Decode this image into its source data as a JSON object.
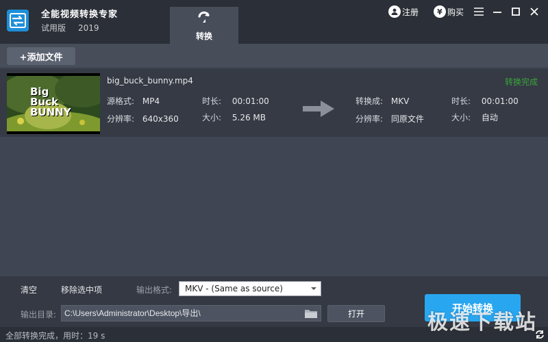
{
  "app": {
    "name": "全能视频转换专家",
    "edition": "试用版",
    "year": "2019"
  },
  "tabs": [
    {
      "label": "转换",
      "icon": "convert-arrow-icon",
      "active": true
    }
  ],
  "top_actions": {
    "register_label": "注册",
    "buy_label": "购买"
  },
  "toolbar": {
    "add_file_label": "+添加文件"
  },
  "files": [
    {
      "name": "big_buck_bunny.mp4",
      "thumbnail_title": "Big Buck BUNNY",
      "source": {
        "format_key": "源格式:",
        "format": "MP4",
        "resolution_key": "分辨率:",
        "resolution": "640x360",
        "duration_key": "时长:",
        "duration": "00:01:00",
        "size_key": "大小:",
        "size": "5.26 MB"
      },
      "target": {
        "format_key": "转换成:",
        "format": "MKV",
        "folder_key": "分辨率:",
        "folder": "同原文件",
        "duration_key": "时长:",
        "duration": "00:01:00",
        "size_key": "大小:",
        "size": "自动"
      },
      "status": "转换完成",
      "status_color": "#3aa53a"
    }
  ],
  "bottom": {
    "clear_label": "清空",
    "remove_selected_label": "移除选中项",
    "output_format_label": "输出格式:",
    "output_format_value": "MKV - (Same as source)",
    "output_dir_label": "输出目录:",
    "output_dir_value": "C:\\Users\\Administrator\\Desktop\\导出\\",
    "open_label": "打开",
    "start_label": "开始转换"
  },
  "statusbar": {
    "text": "全部转换完成，用时：19 s"
  },
  "watermark": "极速下载站",
  "colors": {
    "accent": "#29a6f0",
    "title_bar": "#2b2f37",
    "panel": "#3f4552",
    "row": "#353a44",
    "done": "#3aa53a"
  }
}
